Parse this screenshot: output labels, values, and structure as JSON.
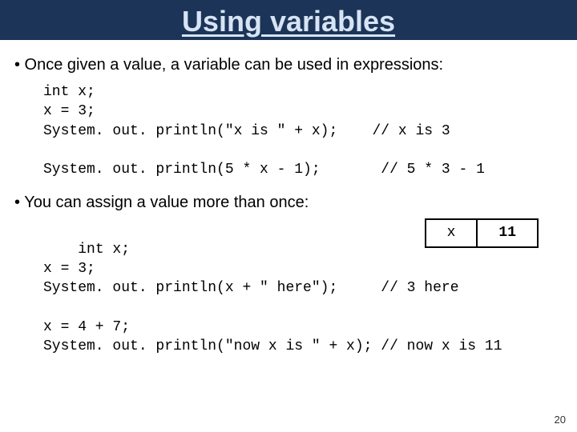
{
  "title": "Using variables",
  "bullet1": "• Once given a value, a variable can be used in expressions:",
  "code1": {
    "l1": "int x;",
    "l2": "x = 3;",
    "l3a": "System. out. println(\"x is \" + x);",
    "l3b": "// x is 3",
    "l4": "",
    "l5a": "System. out. println(5 * x - 1);",
    "l5b": "// 5 * 3 - 1"
  },
  "bullet2": "• You can assign a value more than once:",
  "varbox": {
    "name": "x",
    "value": "11"
  },
  "code2": {
    "l1": "int x;",
    "l2": "x = 3;",
    "l3a": "System. out. println(x + \" here\");",
    "l3b": "// 3 here",
    "l4": "",
    "l5a": "x = 4 + 7;",
    "l6a": "System. out. println(\"now x is \" + x);",
    "l6b": "// now x is 11"
  },
  "pageNumber": "20"
}
